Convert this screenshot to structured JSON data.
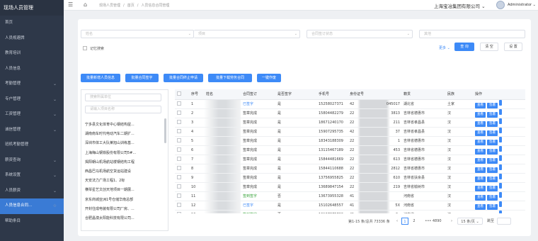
{
  "sidebar": {
    "title": "现场人员管理",
    "items": [
      {
        "label": "首页",
        "arrow": ""
      },
      {
        "label": "人员规避牌",
        "arrow": ""
      },
      {
        "label": "教育培训",
        "arrow": ""
      },
      {
        "label": "人员信息",
        "arrow": ""
      },
      {
        "label": "考勤管理",
        "arrow": "⌄"
      },
      {
        "label": "专户管理",
        "arrow": "⌄"
      },
      {
        "label": "工资管理",
        "arrow": "⌄"
      },
      {
        "label": "诚信管理",
        "arrow": "⌄"
      },
      {
        "label": "班机考勤管理",
        "arrow": ""
      },
      {
        "label": "薪资查询",
        "arrow": "⌄"
      },
      {
        "label": "系统设置",
        "arrow": "⌄"
      },
      {
        "label": "人员薪资",
        "arrow": "⌄"
      },
      {
        "label": "人员信息合同...",
        "arrow": "☆"
      },
      {
        "label": "帮助条目",
        "arrow": ""
      }
    ]
  },
  "topbar": {
    "breadcrumb": [
      "现场人员管理",
      "/",
      "首页",
      "/",
      "人员信息合同管理"
    ],
    "company": "上海宝冶集团有限公司 ⌄",
    "admin": "Administrator ⌄"
  },
  "filters": {
    "name_placeholder": "姓名",
    "project_placeholder": "项目",
    "contract_placeholder": "合同签订状态",
    "other_placeholder": "其他",
    "remember_label": "记忆搜索",
    "more_label": "更多 ⌄",
    "search_label": "查 询",
    "clear_label": "清 空",
    "settings_label": "设 置"
  },
  "actions": {
    "add_label": "批量新增人员信息",
    "sign_label": "批量合同签字",
    "terminate_label": "批量合同终止申请",
    "download_label": "批量下载劳务合同",
    "send_label": "一键作废"
  },
  "tree": {
    "search1": "搜索所属单位",
    "search2": "请输入项目名称",
    "items": [
      "宁多县文化体育中心钢结构屋...",
      "湖南南车时代电动汽车二期扩...",
      "深圳市体工大队莱旭山训练基...",
      "上海梅山钢铁股份有限公司5#...",
      "揭阳朝山机场航站楼钢结构工程",
      "西昌巴马机场航空货运站建设",
      "天安法力广场工程1、2标",
      "横琴星艺文创天地项目一期展...",
      "京东商城亚洲1号仓储华南总部",
      "开封住成电装有限公司厂房、...",
      "合肥晶澳太阳能科技有限公司..."
    ]
  },
  "table": {
    "headers": [
      "",
      "序号",
      "姓名",
      "合同签订",
      "是否签字",
      "手机号",
      "身份证号",
      "籍贯",
      "民族",
      "操作"
    ],
    "rows": [
      {
        "no": "1",
        "name": "",
        "contract": "已签字",
        "cstyle": "link",
        "signed": "是",
        "phone": "15258027371",
        "id": "42",
        "id2": "045017",
        "native": "湖北省",
        "ethnic": "土家"
      },
      {
        "no": "2",
        "name": "",
        "contract": "签章完成",
        "cstyle": "",
        "signed": "是",
        "phone": "15804482279",
        "id": "22",
        "id2": "3813",
        "native": "吉林省德惠市",
        "ethnic": "汉"
      },
      {
        "no": "3",
        "name": "",
        "contract": "签章完成",
        "cstyle": "",
        "signed": "是",
        "phone": "18671240170",
        "id": "22",
        "id2": "211",
        "native": "吉林省孝昌县",
        "ethnic": "汉"
      },
      {
        "no": "4",
        "name": "",
        "contract": "签章完成",
        "cstyle": "",
        "signed": "是",
        "phone": "15907295735",
        "id": "42",
        "id2": "37",
        "native": "吉林省孝昌县",
        "ethnic": "汉"
      },
      {
        "no": "5",
        "name": "",
        "contract": "签章完成",
        "cstyle": "",
        "signed": "是",
        "phone": "18343188309",
        "id": "22",
        "id2": "1",
        "native": "吉林省德惠市",
        "ethnic": "汉"
      },
      {
        "no": "6",
        "name": "",
        "contract": "签章完成",
        "cstyle": "",
        "signed": "是",
        "phone": "13115467189",
        "id": "22",
        "id2": "453",
        "native": "吉林省德惠市",
        "ethnic": "汉"
      },
      {
        "no": "7",
        "name": "",
        "contract": "签章完成",
        "cstyle": "",
        "signed": "是",
        "phone": "15844481669",
        "id": "22",
        "id2": "613",
        "native": "吉林省德惠市",
        "ethnic": "汉"
      },
      {
        "no": "8",
        "name": "",
        "contract": "签章完成",
        "cstyle": "",
        "signed": "是",
        "phone": "15844110688",
        "id": "22",
        "id2": "2812",
        "native": "吉林省德惠市",
        "ethnic": "汉"
      },
      {
        "no": "9",
        "name": "",
        "contract": "签章完成",
        "cstyle": "",
        "signed": "是",
        "phone": "13756955825",
        "id": "22",
        "id2": "610",
        "native": "吉林省扶余县",
        "ethnic": "汉"
      },
      {
        "no": "10",
        "name": "",
        "contract": "签章完成",
        "cstyle": "",
        "signed": "是",
        "phone": "13689847154",
        "id": "22",
        "id2": "219",
        "native": "吉林省榆树市",
        "ethnic": "汉"
      },
      {
        "no": "11",
        "name": "",
        "contract": "签到签字",
        "cstyle": "green",
        "signed": "否",
        "phone": "13673955328",
        "id": "41",
        "id2": "",
        "native": "河南省",
        "ethnic": "汉"
      },
      {
        "no": "12",
        "name": "",
        "contract": "已签字",
        "cstyle": "link",
        "signed": "是",
        "phone": "15102648557",
        "id": "41",
        "id2": "5X",
        "native": "河南省",
        "ethnic": "汉"
      },
      {
        "no": "13",
        "name": "华",
        "contract": "签到签字",
        "cstyle": "green",
        "signed": "否",
        "phone": "13137875763",
        "id": "41",
        "id2": "3x",
        "native": "河南省",
        "ethnic": "汉"
      }
    ],
    "op1": "查看",
    "op2": "签署"
  },
  "pagination": {
    "summary": "第1-15 条/总共 73336 条",
    "prev": "‹",
    "p1": "1",
    "p2": "2",
    "ellipsis": "••• 4890",
    "next": "›",
    "size": "15 条/页 ⌄",
    "jump": "跳至"
  }
}
